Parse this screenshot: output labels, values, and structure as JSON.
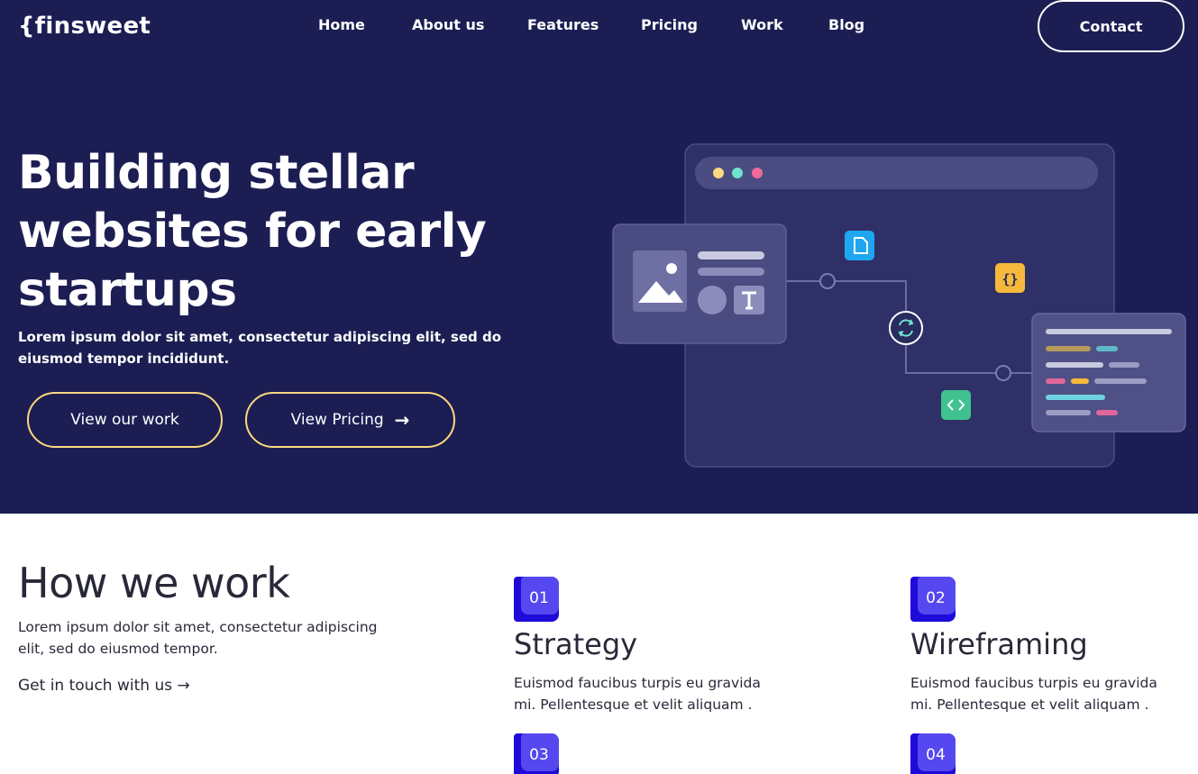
{
  "header": {
    "logo": "{finsweet",
    "nav": [
      "Home",
      "About us",
      "Features",
      "Pricing",
      "Work",
      "Blog"
    ],
    "contact_label": "Contact"
  },
  "hero": {
    "title": "Building stellar websites for early startups",
    "text": "Lorem ipsum dolor sit amet, consectetur adipiscing elit, sed do eiusmod tempor incididunt.",
    "btn_work": "View our work",
    "btn_pricing": "View Pricing"
  },
  "how": {
    "title": "How we work",
    "text": "Lorem ipsum dolor sit amet, consectetur adipiscing elit, sed do eiusmod tempor.",
    "link": "Get in touch with us",
    "steps": [
      {
        "num": "01",
        "title": "Strategy",
        "desc": "Euismod faucibus turpis eu gravida mi. Pellentesque et velit aliquam ."
      },
      {
        "num": "02",
        "title": "Wireframing",
        "desc": "Euismod faucibus turpis eu gravida mi. Pellentesque et velit aliquam ."
      },
      {
        "num": "03",
        "title": "",
        "desc": ""
      },
      {
        "num": "04",
        "title": "",
        "desc": ""
      }
    ]
  },
  "colors": {
    "hero_bg": "#1c1e53",
    "accent_yellow": "#fcd980",
    "accent_blue": "#1e0bd9",
    "text_dark": "#282938"
  },
  "icons": [
    "arrow-right-icon",
    "image-icon",
    "text-icon",
    "file-icon",
    "code-braces-icon",
    "sync-icon",
    "code-icon"
  ]
}
